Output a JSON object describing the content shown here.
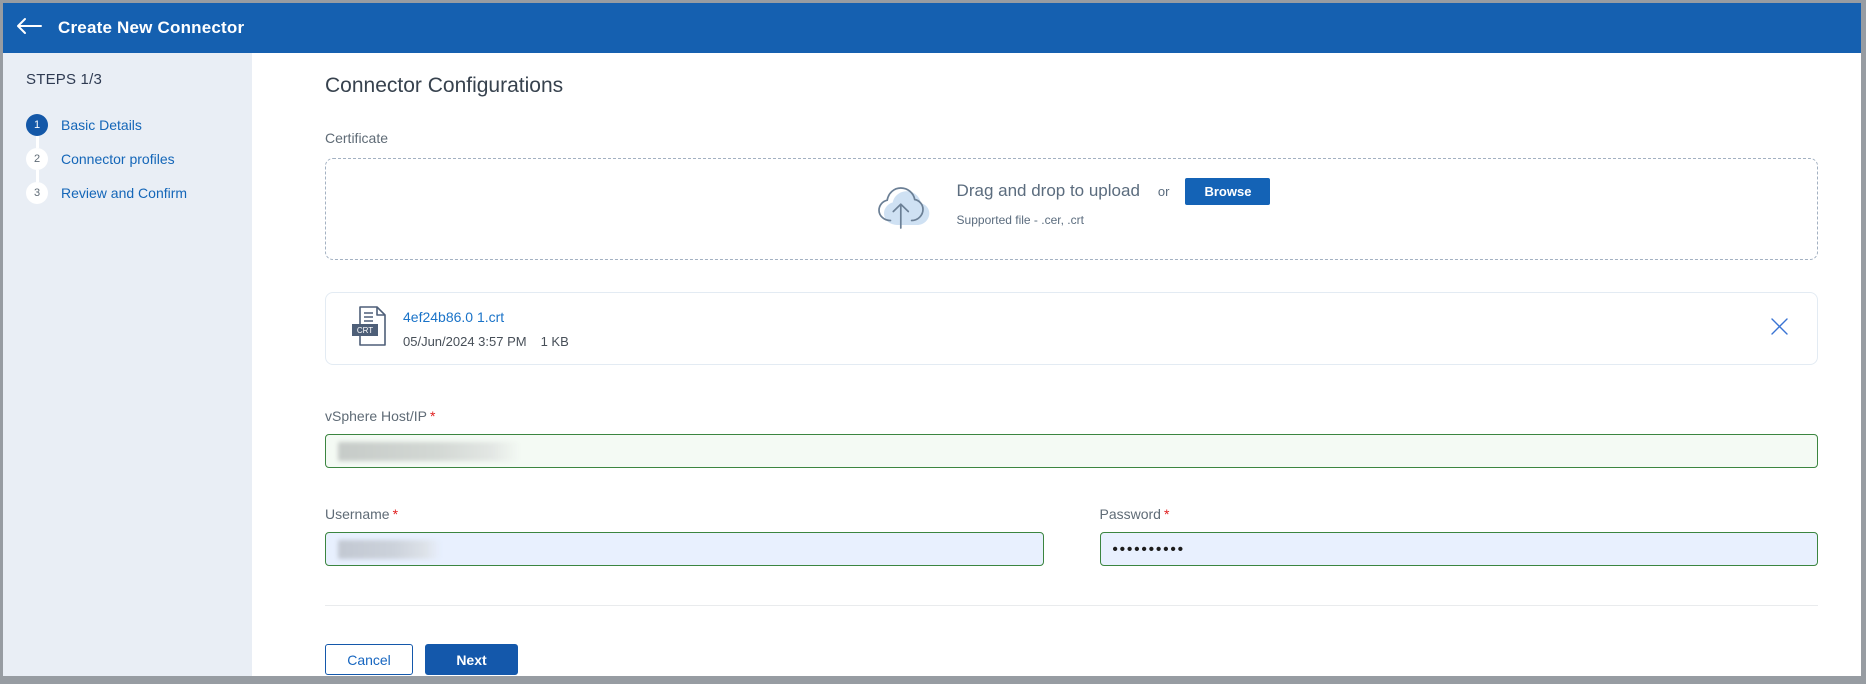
{
  "header": {
    "title": "Create New Connector",
    "back_icon": "arrow-left"
  },
  "sidebar": {
    "steps_label": "STEPS 1/3",
    "steps": [
      {
        "number": "1",
        "label": "Basic Details",
        "state": "active"
      },
      {
        "number": "2",
        "label": "Connector profiles",
        "state": "inactive"
      },
      {
        "number": "3",
        "label": "Review and Confirm",
        "state": "inactive"
      }
    ]
  },
  "main": {
    "title": "Connector Configurations",
    "certificate": {
      "label": "Certificate",
      "dropzone": {
        "icon": "cloud-upload-icon",
        "drag_text": "Drag and drop to upload",
        "or_text": "or",
        "browse_label": "Browse",
        "supported_text": "Supported file -  .cer, .crt"
      },
      "uploaded_file": {
        "type_badge": "CRT",
        "name": "4ef24b86.0 1.crt",
        "date": "05/Jun/2024 3:57 PM",
        "size": "1 KB",
        "remove_icon": "close-icon"
      }
    },
    "fields": {
      "host": {
        "label": "vSphere Host/IP",
        "required_mark": "*",
        "value_redacted": true
      },
      "username": {
        "label": "Username",
        "required_mark": "*",
        "value_redacted": true
      },
      "password": {
        "label": "Password",
        "required_mark": "*",
        "value_masked": "••••••••••"
      }
    },
    "actions": {
      "cancel_label": "Cancel",
      "next_label": "Next"
    }
  },
  "colors": {
    "header_blue": "#1560b0",
    "accent_blue": "#1458ab",
    "link_blue": "#1a73c8",
    "sidebar_bg": "#e9eef5",
    "valid_field_green": "#3b8540",
    "autofill_blue_bg": "#e8f0fe",
    "required_red": "#e02020"
  }
}
